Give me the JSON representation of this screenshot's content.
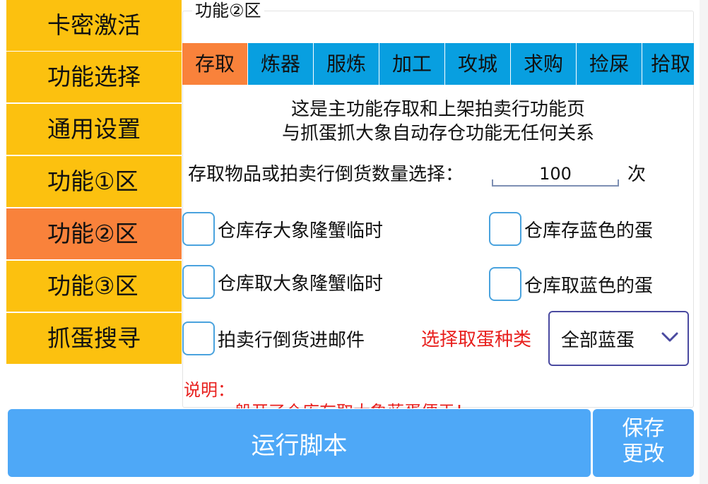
{
  "sidebar": {
    "items": [
      {
        "label": "卡密激活"
      },
      {
        "label": "功能选择"
      },
      {
        "label": "通用设置"
      },
      {
        "label": "功能①区"
      },
      {
        "label": "功能②区"
      },
      {
        "label": "功能③区"
      },
      {
        "label": "抓蛋搜寻"
      }
    ],
    "active_index": 4
  },
  "group": {
    "title": "功能②区"
  },
  "tabs": [
    {
      "label": "存取"
    },
    {
      "label": "炼器"
    },
    {
      "label": "服炼"
    },
    {
      "label": "加工"
    },
    {
      "label": "攻城"
    },
    {
      "label": "求购"
    },
    {
      "label": "捡屎"
    },
    {
      "label": "拾取"
    }
  ],
  "intro": {
    "line1": "这是主功能存取和上架拍卖行功能页",
    "line2": "与抓蛋抓大象自动存仓功能无任何关系"
  },
  "quantity": {
    "label": "存取物品或拍卖行倒货数量选择：",
    "value": "100",
    "unit": "次"
  },
  "checkboxes": [
    {
      "label": "仓库存大象隆蟹临时",
      "checked": false
    },
    {
      "label": "仓库存蓝色的蛋",
      "checked": false
    },
    {
      "label": "仓库取大象隆蟹临时",
      "checked": false
    },
    {
      "label": "仓库取蓝色的蛋",
      "checked": false
    },
    {
      "label": "拍卖行倒货进邮件",
      "checked": false
    }
  ],
  "egg_select": {
    "label": "选择取蛋种类",
    "value": "全部蓝蛋"
  },
  "notes": {
    "title": "说明：",
    "line1": "一般开了仓库存取大象蓝蛋便于！"
  },
  "buttons": {
    "run": "运行脚本",
    "save_line1": "保存",
    "save_line2": "更改"
  },
  "colors": {
    "sidebar_bg": "#fcc10f",
    "active_bg": "#f9823b",
    "tab_bg": "#089fe0",
    "button_bg": "#4ea8f7",
    "accent_red": "#e8201e",
    "checkbox_border": "#4aa3de"
  }
}
